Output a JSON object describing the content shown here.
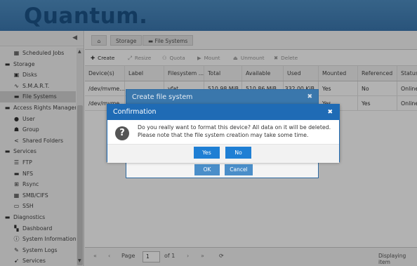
{
  "brand": {
    "logo_text": "Quantum",
    "logo_dot": "."
  },
  "sidebar": {
    "collapse_icon": "chevron-left-icon",
    "items": [
      {
        "label": "Scheduled Jobs",
        "icon": "calendar-icon",
        "level": 1
      },
      {
        "label": "Storage",
        "icon": "minus-square-icon",
        "level": 0
      },
      {
        "label": "Disks",
        "icon": "disk-icon",
        "level": 1
      },
      {
        "label": "S.M.A.R.T.",
        "icon": "pulse-icon",
        "level": 1
      },
      {
        "label": "File Systems",
        "icon": "folder-icon",
        "level": 1,
        "active": true
      },
      {
        "label": "Access Rights Managemer",
        "icon": "minus-square-icon",
        "level": 0
      },
      {
        "label": "User",
        "icon": "user-icon",
        "level": 1
      },
      {
        "label": "Group",
        "icon": "group-icon",
        "level": 1
      },
      {
        "label": "Shared Folders",
        "icon": "share-icon",
        "level": 1
      },
      {
        "label": "Services",
        "icon": "minus-square-icon",
        "level": 0
      },
      {
        "label": "FTP",
        "icon": "server-icon",
        "level": 1
      },
      {
        "label": "NFS",
        "icon": "monitor-icon",
        "level": 1
      },
      {
        "label": "Rsync",
        "icon": "sitemap-icon",
        "level": 1
      },
      {
        "label": "SMB/CIFS",
        "icon": "windows-icon",
        "level": 1
      },
      {
        "label": "SSH",
        "icon": "terminal-icon",
        "level": 1
      },
      {
        "label": "Diagnostics",
        "icon": "minus-square-icon",
        "level": 0
      },
      {
        "label": "Dashboard",
        "icon": "dashboard-icon",
        "level": 1
      },
      {
        "label": "System Information",
        "icon": "info-icon",
        "level": 1
      },
      {
        "label": "System Logs",
        "icon": "edit-icon",
        "level": 1
      },
      {
        "label": "Services",
        "icon": "rocket-icon",
        "level": 1
      }
    ]
  },
  "breadcrumbs": [
    {
      "label": "",
      "icon": "home-icon"
    },
    {
      "label": "Storage"
    },
    {
      "label": "File Systems",
      "icon": "folder-icon"
    }
  ],
  "toolbar": {
    "create": "Create",
    "resize": "Resize",
    "quota": "Quota",
    "mount": "Mount",
    "unmount": "Unmount",
    "delete": "Delete"
  },
  "grid": {
    "columns": [
      "Device(s)",
      "Label",
      "Filesystem ...",
      "Total",
      "Available",
      "Used",
      "Mounted",
      "Referenced",
      "Status"
    ],
    "rows": [
      [
        "/dev/mvme...",
        "",
        "vfat",
        "510.98 MiB",
        "510.86 MiB",
        "332.00 KiB",
        "Yes",
        "No",
        "Online"
      ],
      [
        "/dev/mvme...",
        "",
        "",
        "",
        "",
        "",
        "Yes",
        "Yes",
        "Online"
      ]
    ]
  },
  "pager": {
    "first": "«",
    "prev": "‹",
    "page_label": "Page",
    "page_value": "1",
    "of_label": "of 1",
    "next": "›",
    "last": "»",
    "refresh": "⟳",
    "displaying": "Displaying item"
  },
  "create_dialog": {
    "title": "Create file system",
    "ok": "OK",
    "cancel": "Cancel"
  },
  "confirm_dialog": {
    "title": "Confirmation",
    "message": "Do you really want to format this device? All data on it will be deleted. Please note that the file system creation may take some time.",
    "yes": "Yes",
    "no": "No"
  },
  "colors": {
    "header": "#3f7fb8",
    "logo": "#1c5488",
    "dialog_title": "#1f6bb5",
    "button": "#1f7fd4"
  }
}
